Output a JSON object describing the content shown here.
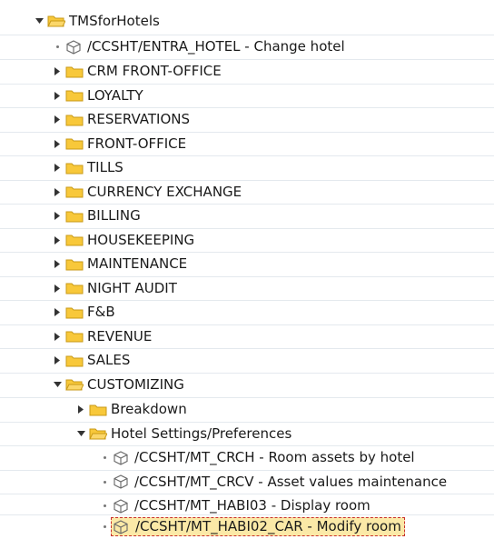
{
  "tree": {
    "root": {
      "label": "TMSforHotels"
    },
    "root_transaction": {
      "label": "/CCSHT/ENTRA_HOTEL - Change hotel"
    },
    "folders": [
      {
        "label": "CRM FRONT-OFFICE"
      },
      {
        "label": "LOYALTY"
      },
      {
        "label": "RESERVATIONS"
      },
      {
        "label": "FRONT-OFFICE"
      },
      {
        "label": "TILLS"
      },
      {
        "label": "CURRENCY EXCHANGE"
      },
      {
        "label": "BILLING"
      },
      {
        "label": "HOUSEKEEPING"
      },
      {
        "label": "MAINTENANCE"
      },
      {
        "label": "NIGHT AUDIT"
      },
      {
        "label": "F&B"
      },
      {
        "label": "REVENUE"
      },
      {
        "label": "SALES"
      }
    ],
    "customizing": {
      "label": "CUSTOMIZING",
      "breakdown": {
        "label": "Breakdown"
      },
      "hotel_settings": {
        "label": "Hotel Settings/Preferences",
        "transactions": [
          {
            "label": "/CCSHT/MT_CRCH - Room assets by hotel"
          },
          {
            "label": "/CCSHT/MT_CRCV - Asset values maintenance"
          },
          {
            "label": "/CCSHT/MT_HABI03 - Display room"
          },
          {
            "label": "/CCSHT/MT_HABI02_CAR - Modify room"
          }
        ]
      }
    },
    "colors": {
      "folder_fill": "#f8c83a",
      "folder_stroke": "#c99a17",
      "arrow": "#333333",
      "selection_bg": "#fbe9a7",
      "selection_border": "#c9302c"
    }
  }
}
